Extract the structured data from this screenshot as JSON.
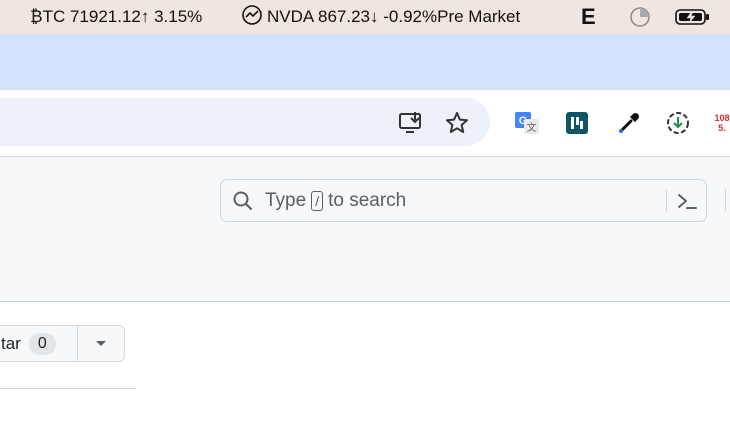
{
  "menubar": {
    "btc_ticker": "₿TC 71921.12↑ 3.15%",
    "nvda_ticker": "NVDA  867.23↓  -0.92%Pre Market",
    "e_app": "E"
  },
  "browser": {
    "extension_badge_top": "108",
    "extension_badge_bottom": "5."
  },
  "search": {
    "prefix": "Type",
    "key": "/",
    "suffix": "to search"
  },
  "repo": {
    "star_label": "tar",
    "star_count": "0"
  }
}
